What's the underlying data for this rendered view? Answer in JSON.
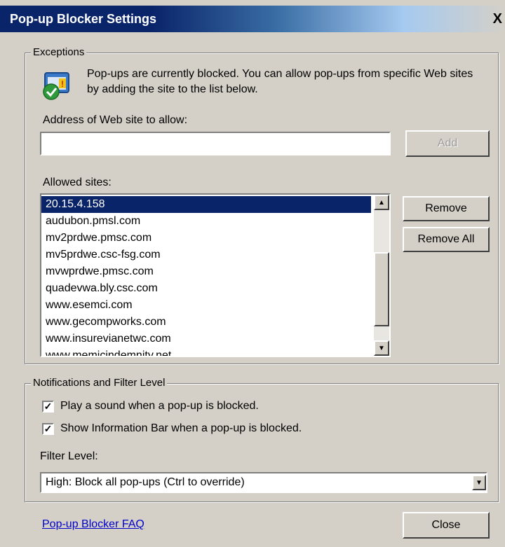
{
  "window": {
    "title": "Pop-up Blocker Settings",
    "close_glyph": "X"
  },
  "exceptions": {
    "group_label": "Exceptions",
    "icon": "popup-blocker-shield-icon",
    "description": "Pop-ups are currently blocked.  You can allow pop-ups from specific Web sites by adding the site to the list below.",
    "address_label": "Address of Web site to allow:",
    "address_value": "",
    "add_label": "Add",
    "allowed_label": "Allowed sites:",
    "allowed_sites": [
      "20.15.4.158",
      "audubon.pmsl.com",
      "mv2prdwe.pmsc.com",
      "mv5prdwe.csc-fsg.com",
      "mvwprdwe.pmsc.com",
      "quadevwa.bly.csc.com",
      "www.esemci.com",
      "www.gecompworks.com",
      "www.insurevianetwc.com",
      "www.memicindemnity.net"
    ],
    "selected_index": 0,
    "remove_label": "Remove",
    "remove_all_label": "Remove All"
  },
  "notifications": {
    "group_label": "Notifications and Filter Level",
    "play_sound_label": "Play a sound when a pop-up is blocked.",
    "play_sound_checked": true,
    "show_infobar_label": "Show Information Bar when a pop-up is blocked.",
    "show_infobar_checked": true,
    "filter_label": "Filter Level:",
    "filter_value": "High: Block all pop-ups (Ctrl to override)"
  },
  "footer": {
    "faq_label": "Pop-up Blocker FAQ",
    "close_label": "Close"
  }
}
